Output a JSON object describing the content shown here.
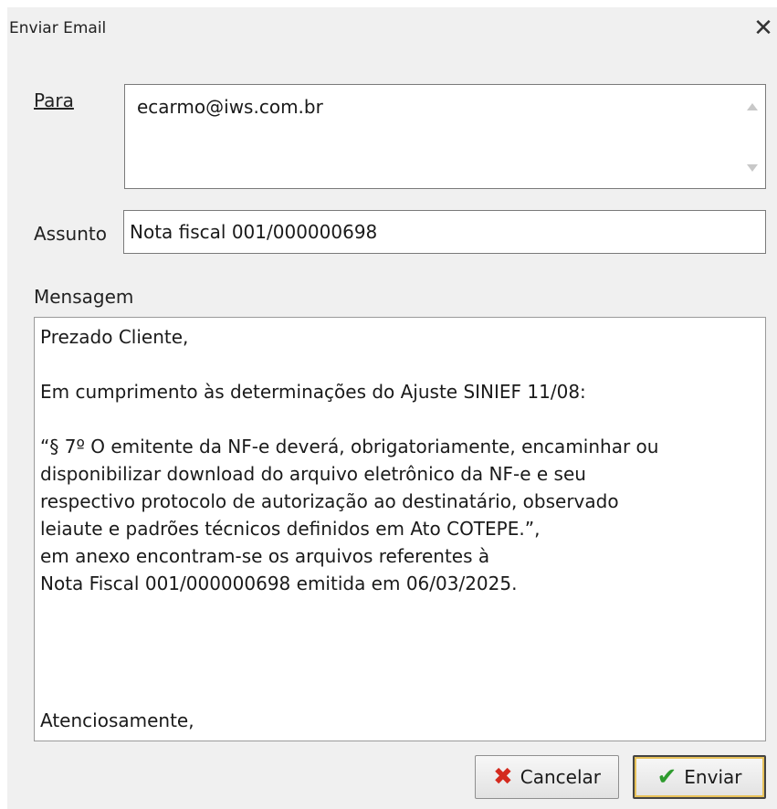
{
  "window": {
    "title": "Enviar Email",
    "close_glyph": "✕"
  },
  "form": {
    "to_label": "Para",
    "to_value": "ecarmo@iws.com.br",
    "subject_label": "Assunto",
    "subject_value": "Nota fiscal 001/000000698",
    "message_label": "Mensagem",
    "message_lines": [
      "Prezado Cliente,",
      "",
      "Em cumprimento às determinações do Ajuste SINIEF 11/08:",
      "",
      "“§ 7º O emitente da NF-e deverá, obrigatoriamente, encaminhar ou",
      "disponibilizar download do arquivo eletrônico da NF-e e seu",
      "respectivo protocolo de autorização ao destinatário, observado",
      "leiaute e padrões técnicos definidos em Ato COTEPE.”,",
      "em anexo encontram-se os arquivos referentes à",
      "Nota Fiscal 001/000000698 emitida em 06/03/2025.",
      "",
      "",
      "",
      "",
      "Atenciosamente,"
    ]
  },
  "buttons": {
    "cancel_label": "Cancelar",
    "cancel_icon": "x-icon",
    "send_label": "Enviar",
    "send_icon": "check-icon"
  },
  "colors": {
    "cancel_icon": "#d42a1e",
    "send_icon": "#2e9b2e",
    "default_button_focus": "#e8c25a"
  }
}
